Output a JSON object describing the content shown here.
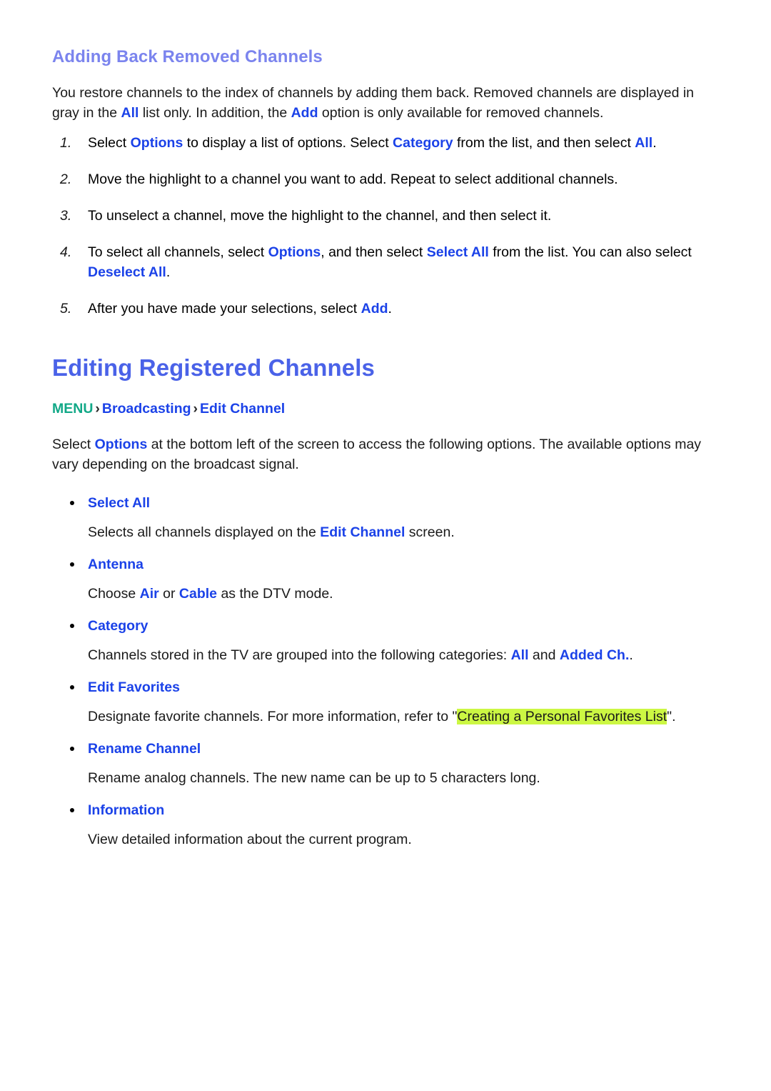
{
  "section1": {
    "heading": "Adding Back Removed Channels",
    "intro": {
      "part1": "You restore channels to the index of channels by adding them back. Removed channels are displayed in gray in the ",
      "em1": "All",
      "part2": " list only. In addition, the ",
      "em2": "Add",
      "part3": " option is only available for removed channels."
    },
    "steps": [
      {
        "num": "1.",
        "part1": "Select ",
        "em1": "Options",
        "part2": " to display a list of options. Select ",
        "em2": "Category",
        "part3": " from the list, and then select ",
        "em3": "All",
        "part4": "."
      },
      {
        "num": "2.",
        "part1": "Move the highlight to a channel you want to add. Repeat to select additional channels.",
        "em1": "",
        "part2": "",
        "em2": "",
        "part3": "",
        "em3": "",
        "part4": ""
      },
      {
        "num": "3.",
        "part1": "To unselect a channel, move the highlight to the channel, and then select it.",
        "em1": "",
        "part2": "",
        "em2": "",
        "part3": "",
        "em3": "",
        "part4": ""
      },
      {
        "num": "4.",
        "part1": "To select all channels, select ",
        "em1": "Options",
        "part2": ", and then select ",
        "em2": "Select All",
        "part3": " from the list. You can also select ",
        "em3": "Deselect All",
        "part4": "."
      },
      {
        "num": "5.",
        "part1": "After you have made your selections, select ",
        "em1": "Add",
        "part2": ".",
        "em2": "",
        "part3": "",
        "em3": "",
        "part4": ""
      }
    ]
  },
  "section2": {
    "heading": "Editing Registered Channels",
    "breadcrumb": {
      "root": "MENU",
      "sep1": "›",
      "level2": "Broadcasting",
      "sep2": "›",
      "level3": "Edit Channel"
    },
    "intro": {
      "part1": "Select ",
      "em1": "Options",
      "part2": " at the bottom left of the screen to access the following options. The available options may vary depending on the broadcast signal."
    },
    "options": [
      {
        "label": "Select All",
        "desc_part1": "Selects all channels displayed on the ",
        "desc_em1": "Edit Channel",
        "desc_part2": " screen.",
        "desc_em2": "",
        "desc_part3": ""
      },
      {
        "label": "Antenna",
        "desc_part1": "Choose ",
        "desc_em1": "Air",
        "desc_part2": " or ",
        "desc_em2": "Cable",
        "desc_part3": " as the DTV mode."
      },
      {
        "label": "Category",
        "desc_part1": "Channels stored in the TV are grouped into the following categories: ",
        "desc_em1": "All",
        "desc_part2": " and ",
        "desc_em2": "Added Ch.",
        "desc_part3": "."
      },
      {
        "label": "Edit Favorites",
        "desc_part1": "Designate favorite channels. For more information, refer to \"",
        "desc_highlight": "Creating a Personal Favorites List",
        "desc_part2": "\".",
        "desc_em1": "",
        "desc_em2": "",
        "desc_part3": ""
      },
      {
        "label": "Rename Channel",
        "desc_part1": "Rename analog channels. The new name can be up to 5 characters long.",
        "desc_em1": "",
        "desc_part2": "",
        "desc_em2": "",
        "desc_part3": ""
      },
      {
        "label": "Information",
        "desc_part1": "View detailed information about the current program.",
        "desc_em1": "",
        "desc_part2": "",
        "desc_em2": "",
        "desc_part3": ""
      }
    ]
  },
  "colors": {
    "subheading": "#7b84ee",
    "mainheading": "#4a62e8",
    "inline_emphasis": "#1b42e8",
    "menu_root": "#11a887",
    "highlight": "#ccf743"
  }
}
